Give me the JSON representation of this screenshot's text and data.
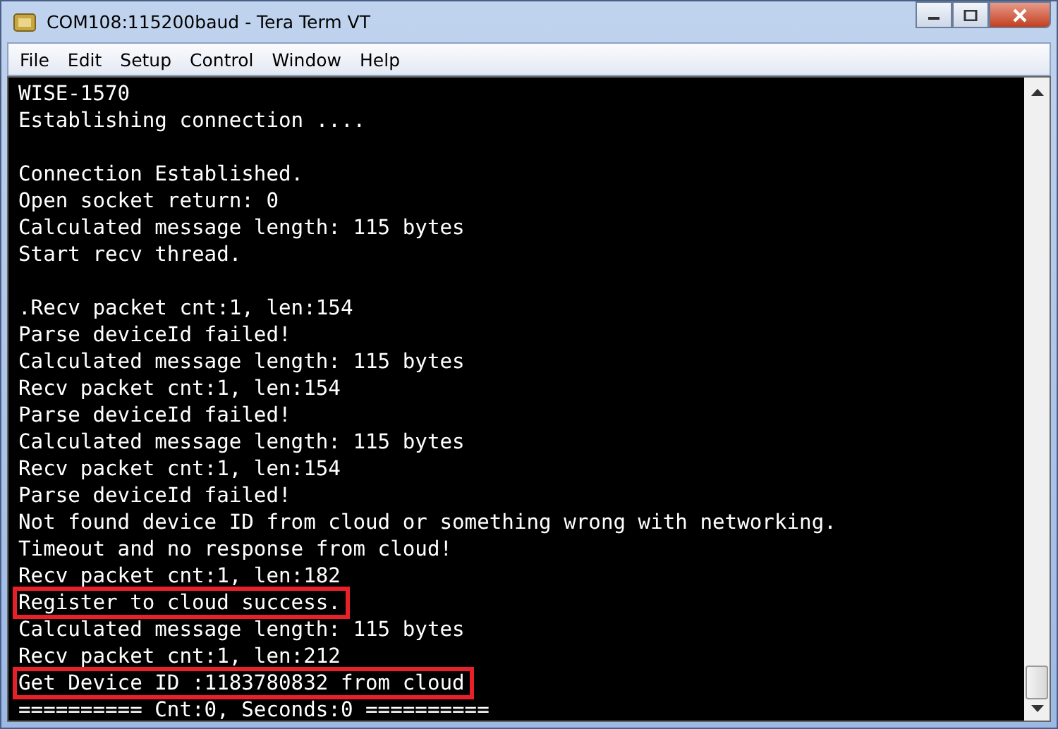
{
  "window": {
    "title": "COM108:115200baud - Tera Term VT"
  },
  "menu": [
    "File",
    "Edit",
    "Setup",
    "Control",
    "Window",
    "Help"
  ],
  "terminal": {
    "lines": [
      {
        "text": "WISE-1570",
        "highlighted": false,
        "blank_line_before": false
      },
      {
        "text": "Establishing connection ....",
        "highlighted": false,
        "blank_line_before": false
      },
      {
        "text": "Connection Established.",
        "highlighted": false,
        "blank_line_before": true
      },
      {
        "text": "Open socket return: 0",
        "highlighted": false,
        "blank_line_before": false
      },
      {
        "text": "Calculated message length: 115 bytes",
        "highlighted": false,
        "blank_line_before": false
      },
      {
        "text": "Start recv thread.",
        "highlighted": false,
        "blank_line_before": false
      },
      {
        "text": ".Recv packet cnt:1, len:154",
        "highlighted": false,
        "blank_line_before": true
      },
      {
        "text": "Parse deviceId failed!",
        "highlighted": false,
        "blank_line_before": false
      },
      {
        "text": "Calculated message length: 115 bytes",
        "highlighted": false,
        "blank_line_before": false
      },
      {
        "text": "Recv packet cnt:1, len:154",
        "highlighted": false,
        "blank_line_before": false
      },
      {
        "text": "Parse deviceId failed!",
        "highlighted": false,
        "blank_line_before": false
      },
      {
        "text": "Calculated message length: 115 bytes",
        "highlighted": false,
        "blank_line_before": false
      },
      {
        "text": "Recv packet cnt:1, len:154",
        "highlighted": false,
        "blank_line_before": false
      },
      {
        "text": "Parse deviceId failed!",
        "highlighted": false,
        "blank_line_before": false
      },
      {
        "text": "Not found device ID from cloud or something wrong with networking.",
        "highlighted": false,
        "blank_line_before": false
      },
      {
        "text": "Timeout and no response from cloud!",
        "highlighted": false,
        "blank_line_before": false
      },
      {
        "text": "Recv packet cnt:1, len:182",
        "highlighted": false,
        "blank_line_before": false
      },
      {
        "text": "Register to cloud success.",
        "highlighted": true,
        "blank_line_before": false
      },
      {
        "text": "Calculated message length: 115 bytes",
        "highlighted": false,
        "blank_line_before": false
      },
      {
        "text": "Recv packet cnt:1, len:212",
        "highlighted": false,
        "blank_line_before": false
      },
      {
        "text": "Get Device ID :1183780832 from cloud",
        "highlighted": true,
        "blank_line_before": false
      },
      {
        "text": "========== Cnt:0, Seconds:0 ==========",
        "highlighted": false,
        "blank_line_before": false
      }
    ]
  }
}
